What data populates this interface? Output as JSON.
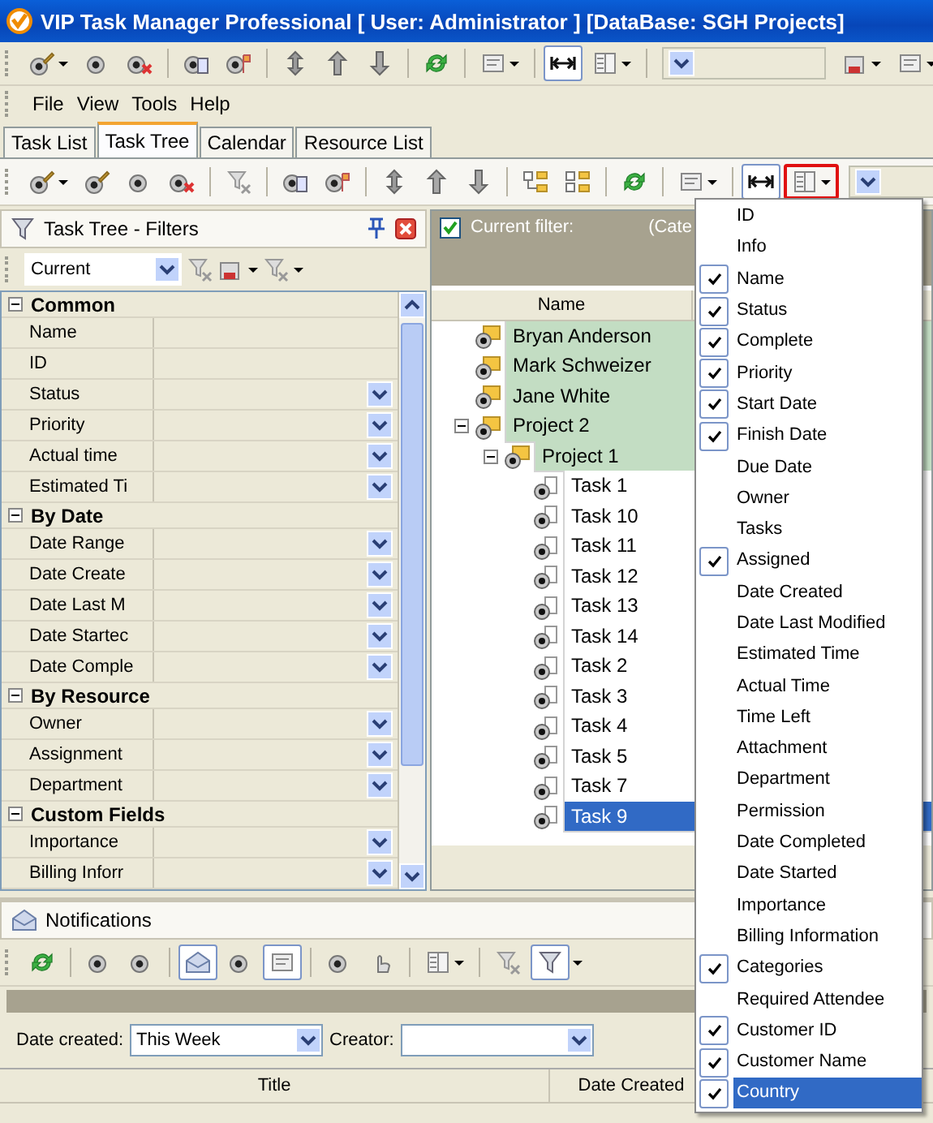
{
  "window": {
    "title": "VIP Task Manager Professional [ User: Administrator ] [DataBase: SGH Projects]"
  },
  "menu": [
    "File",
    "View",
    "Tools",
    "Help"
  ],
  "tabs": [
    {
      "label": "Task List",
      "selected": false
    },
    {
      "label": "Task Tree",
      "selected": true
    },
    {
      "label": "Calendar",
      "selected": false
    },
    {
      "label": "Resource List",
      "selected": false
    }
  ],
  "columns_menu": {
    "open": true,
    "items": [
      {
        "label": "ID",
        "checked": false,
        "selected": false
      },
      {
        "label": "Info",
        "checked": false,
        "selected": false
      },
      {
        "label": "Name",
        "checked": true,
        "selected": false
      },
      {
        "label": "Status",
        "checked": true,
        "selected": false
      },
      {
        "label": "Complete",
        "checked": true,
        "selected": false
      },
      {
        "label": "Priority",
        "checked": true,
        "selected": false
      },
      {
        "label": "Start Date",
        "checked": true,
        "selected": false
      },
      {
        "label": "Finish Date",
        "checked": true,
        "selected": false
      },
      {
        "label": "Due Date",
        "checked": false,
        "selected": false
      },
      {
        "label": "Owner",
        "checked": false,
        "selected": false
      },
      {
        "label": "Tasks",
        "checked": false,
        "selected": false
      },
      {
        "label": "Assigned",
        "checked": true,
        "selected": false
      },
      {
        "label": "Date Created",
        "checked": false,
        "selected": false
      },
      {
        "label": "Date Last Modified",
        "checked": false,
        "selected": false
      },
      {
        "label": "Estimated Time",
        "checked": false,
        "selected": false
      },
      {
        "label": "Actual Time",
        "checked": false,
        "selected": false
      },
      {
        "label": "Time Left",
        "checked": false,
        "selected": false
      },
      {
        "label": "Attachment",
        "checked": false,
        "selected": false
      },
      {
        "label": "Department",
        "checked": false,
        "selected": false
      },
      {
        "label": "Permission",
        "checked": false,
        "selected": false
      },
      {
        "label": "Date Completed",
        "checked": false,
        "selected": false
      },
      {
        "label": "Date Started",
        "checked": false,
        "selected": false
      },
      {
        "label": "Importance",
        "checked": false,
        "selected": false
      },
      {
        "label": "Billing Information",
        "checked": false,
        "selected": false
      },
      {
        "label": "Categories",
        "checked": true,
        "selected": false
      },
      {
        "label": "Required Attendee",
        "checked": false,
        "selected": false
      },
      {
        "label": "Customer ID",
        "checked": true,
        "selected": false
      },
      {
        "label": "Customer Name",
        "checked": true,
        "selected": false
      },
      {
        "label": "Country",
        "checked": true,
        "selected": true
      }
    ]
  },
  "filters_panel": {
    "title": "Task Tree - Filters",
    "preset": "Current",
    "categories": [
      {
        "label": "Common",
        "expanded": true,
        "items": [
          {
            "label": "Name",
            "dropdown": false
          },
          {
            "label": "ID",
            "dropdown": false
          },
          {
            "label": "Status",
            "dropdown": true
          },
          {
            "label": "Priority",
            "dropdown": true
          },
          {
            "label": "Actual time",
            "dropdown": true
          },
          {
            "label": "Estimated Ti",
            "dropdown": true
          }
        ]
      },
      {
        "label": "By Date",
        "expanded": true,
        "items": [
          {
            "label": "Date Range",
            "dropdown": true
          },
          {
            "label": "Date Create",
            "dropdown": true
          },
          {
            "label": "Date Last M",
            "dropdown": true
          },
          {
            "label": "Date Startec",
            "dropdown": true
          },
          {
            "label": "Date Comple",
            "dropdown": true
          }
        ]
      },
      {
        "label": "By Resource",
        "expanded": true,
        "items": [
          {
            "label": "Owner",
            "dropdown": true
          },
          {
            "label": "Assignment",
            "dropdown": true
          },
          {
            "label": "Department",
            "dropdown": true
          }
        ]
      },
      {
        "label": "Custom Fields",
        "expanded": true,
        "items": [
          {
            "label": "Importance",
            "dropdown": true
          },
          {
            "label": "Billing Inforr",
            "dropdown": true
          }
        ]
      }
    ]
  },
  "task_tree": {
    "filter_enabled": true,
    "filter_label": "Current filter:",
    "filter_value": "(Cate",
    "columns": [
      "Name"
    ],
    "nodes": [
      {
        "kind": "group",
        "label": "Bryan Anderson",
        "selected": false
      },
      {
        "kind": "group",
        "label": "Mark Schweizer",
        "selected": false
      },
      {
        "kind": "group",
        "label": "Jane White",
        "selected": false
      },
      {
        "kind": "group",
        "label": "Project 2",
        "selected": false,
        "expanded": true,
        "children": [
          {
            "kind": "group",
            "label": "Project 1",
            "selected": false,
            "expanded": true,
            "children": [
              {
                "kind": "task",
                "label": "Task 1",
                "selected": false
              },
              {
                "kind": "task",
                "label": "Task 10",
                "selected": false
              },
              {
                "kind": "task",
                "label": "Task 11",
                "selected": false
              },
              {
                "kind": "task",
                "label": "Task 12",
                "selected": false
              },
              {
                "kind": "task",
                "label": "Task 13",
                "selected": false
              },
              {
                "kind": "task",
                "label": "Task 14",
                "selected": false
              },
              {
                "kind": "task",
                "label": "Task 2",
                "selected": false
              },
              {
                "kind": "task",
                "label": "Task 3",
                "selected": false
              },
              {
                "kind": "task",
                "label": "Task 4",
                "selected": false
              },
              {
                "kind": "task",
                "label": "Task 5",
                "selected": false
              },
              {
                "kind": "task",
                "label": "Task 7",
                "selected": false
              },
              {
                "kind": "task",
                "label": "Task 9",
                "selected": true
              }
            ]
          }
        ]
      }
    ]
  },
  "notifications": {
    "title": "Notifications",
    "date_created_label": "Date created:",
    "date_created_value": "This Week",
    "creator_label": "Creator:",
    "columns": [
      "Title",
      "Date Created"
    ]
  }
}
